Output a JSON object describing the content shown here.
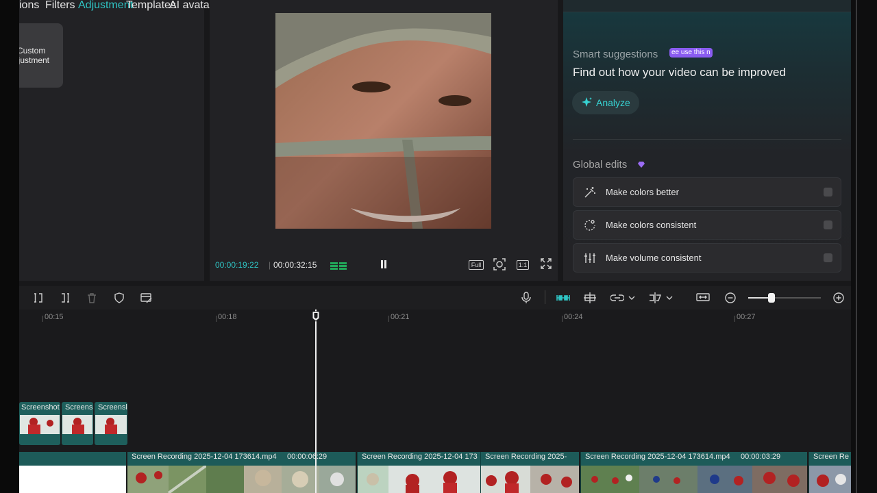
{
  "left_panel": {
    "tabs": [
      {
        "label": "ions",
        "active": false
      },
      {
        "label": "Filters",
        "active": false
      },
      {
        "label": "Adjustment",
        "active": true
      },
      {
        "label": "Templates",
        "active": false
      },
      {
        "label": "AI avatar",
        "active": false
      }
    ],
    "custom_card": {
      "line1": "Custom",
      "line2": "ljustment"
    }
  },
  "preview": {
    "current_time": "00:00:19:22",
    "separator": "|",
    "total_time": "00:00:32:15",
    "full_label": "Full",
    "ratio_label": "1:1"
  },
  "right_panel": {
    "smart_suggestions_label": "Smart suggestions",
    "badge": "ee use this n",
    "headline": "Find out how your video can be improved",
    "analyze_label": "Analyze",
    "global_edits_label": "Global edits",
    "items": [
      {
        "label": "Make colors better",
        "icon": "magic-wand-icon"
      },
      {
        "label": "Make colors consistent",
        "icon": "color-sync-icon"
      },
      {
        "label": "Make volume consistent",
        "icon": "sliders-icon"
      }
    ],
    "accent": "#37d3d3",
    "badge_color": "#8a5cf0"
  },
  "timeline": {
    "ruler": [
      "00:15",
      "00:18",
      "00:21",
      "00:24",
      "00:27"
    ],
    "screenshot_clips": [
      "Screenshot",
      "Screens",
      "Screensl"
    ],
    "video_clips": [
      {
        "name": "Screen Recording 2025-12-04 173614.mp4",
        "duration": "00:00:06:29"
      },
      {
        "name": "Screen Recording 2025-12-04 173",
        "duration": ""
      },
      {
        "name": "Screen Recording 2025-",
        "duration": ""
      },
      {
        "name": "Screen Recording 2025-12-04 173614.mp4",
        "duration": "00:00:03:29"
      },
      {
        "name": "Screen Re",
        "duration": ""
      }
    ]
  }
}
